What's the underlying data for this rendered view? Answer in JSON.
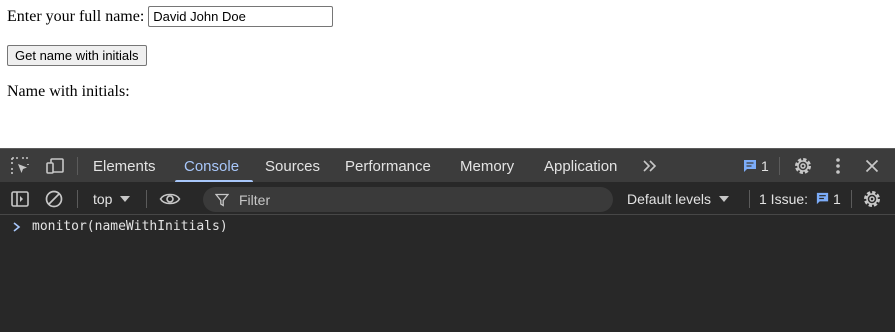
{
  "page": {
    "name_label": "Enter your full name:",
    "name_value": "David John Doe",
    "button_label": "Get name with initials",
    "result_label": "Name with initials:"
  },
  "devtools": {
    "tabs": [
      "Elements",
      "Console",
      "Sources",
      "Performance",
      "Memory",
      "Application"
    ],
    "active_tab": "Console",
    "messages_count": "1",
    "toolbar": {
      "context": "top",
      "filter_placeholder": "Filter",
      "levels": "Default levels",
      "issues_label": "1 Issue:",
      "issues_count": "1"
    },
    "console_input": "monitor(nameWithInitials)",
    "colors": {
      "accent": "#a8c7fa",
      "panel_bg": "#282828",
      "tabbar_bg": "#3c3c3c"
    }
  }
}
